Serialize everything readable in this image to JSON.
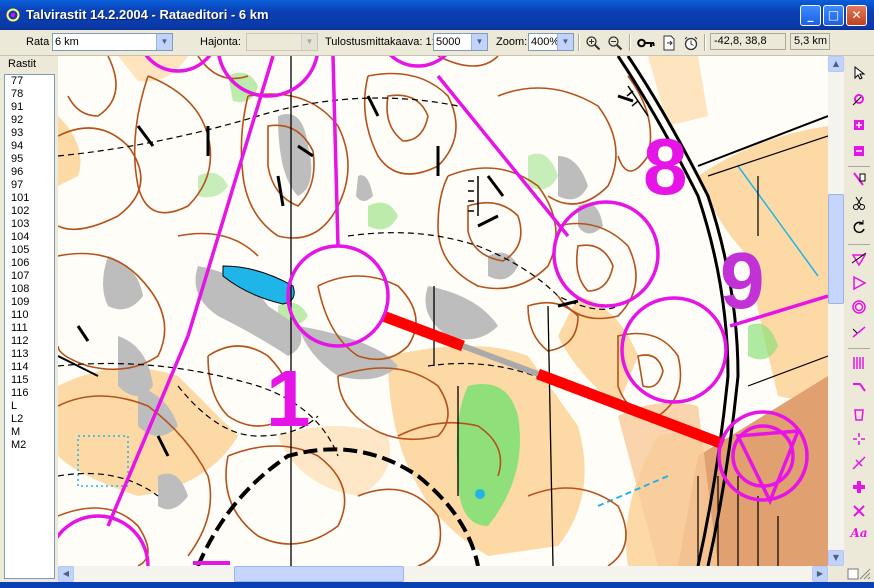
{
  "window": {
    "title": "Talvirastit 14.2.2004 - Rataeditori - 6 km",
    "minimize_label": "_",
    "maximize_label": "□",
    "close_label": "✕"
  },
  "toolbar": {
    "rata_label": "Rata",
    "rata_value": "6 km",
    "hajonta_label": "Hajonta:",
    "hajonta_value": "",
    "scale_label": "Tulostusmittakaava: 1:",
    "scale_value": "5000",
    "zoom_label": "Zoom:",
    "zoom_value": "400%",
    "coordinates": "-42,8, 38,8",
    "course_length": "5,3 km",
    "icons": [
      "zoom-in-icon",
      "zoom-out-icon",
      "key-icon",
      "document-arrow-icon",
      "clock-icon"
    ]
  },
  "controls_panel": {
    "title": "Rastit",
    "items": [
      "77",
      "78",
      "91",
      "92",
      "93",
      "94",
      "95",
      "96",
      "97",
      "101",
      "102",
      "103",
      "104",
      "105",
      "106",
      "107",
      "108",
      "109",
      "110",
      "111",
      "112",
      "113",
      "114",
      "115",
      "116",
      "L",
      "L2",
      "M",
      "M2"
    ]
  },
  "map": {
    "control_numbers": [
      "8",
      "9",
      "1"
    ],
    "colors": {
      "course": "#e614e6",
      "contour": "#b5521b",
      "forbidden_route": "#ff0000",
      "open_land": "#fdd9a6",
      "green": "#8fe07a",
      "rock": "#bdbdbd",
      "water": "#1fb5e8",
      "road": "#000000"
    }
  },
  "right_tools": [
    "pointer-icon",
    "add-control-icon",
    "insert-control-icon",
    "delete-control-icon",
    "move-number-icon",
    "cut-leg-icon",
    "rotate-icon",
    "start-triangle-icon",
    "finish-icon",
    "control-circle-icon",
    "leg-line-icon",
    "forbidden-crossing-icon",
    "out-of-bounds-line-icon",
    "water-point-icon",
    "first-aid-icon",
    "crossing-point-icon",
    "forbidden-icon",
    "text-icon"
  ]
}
